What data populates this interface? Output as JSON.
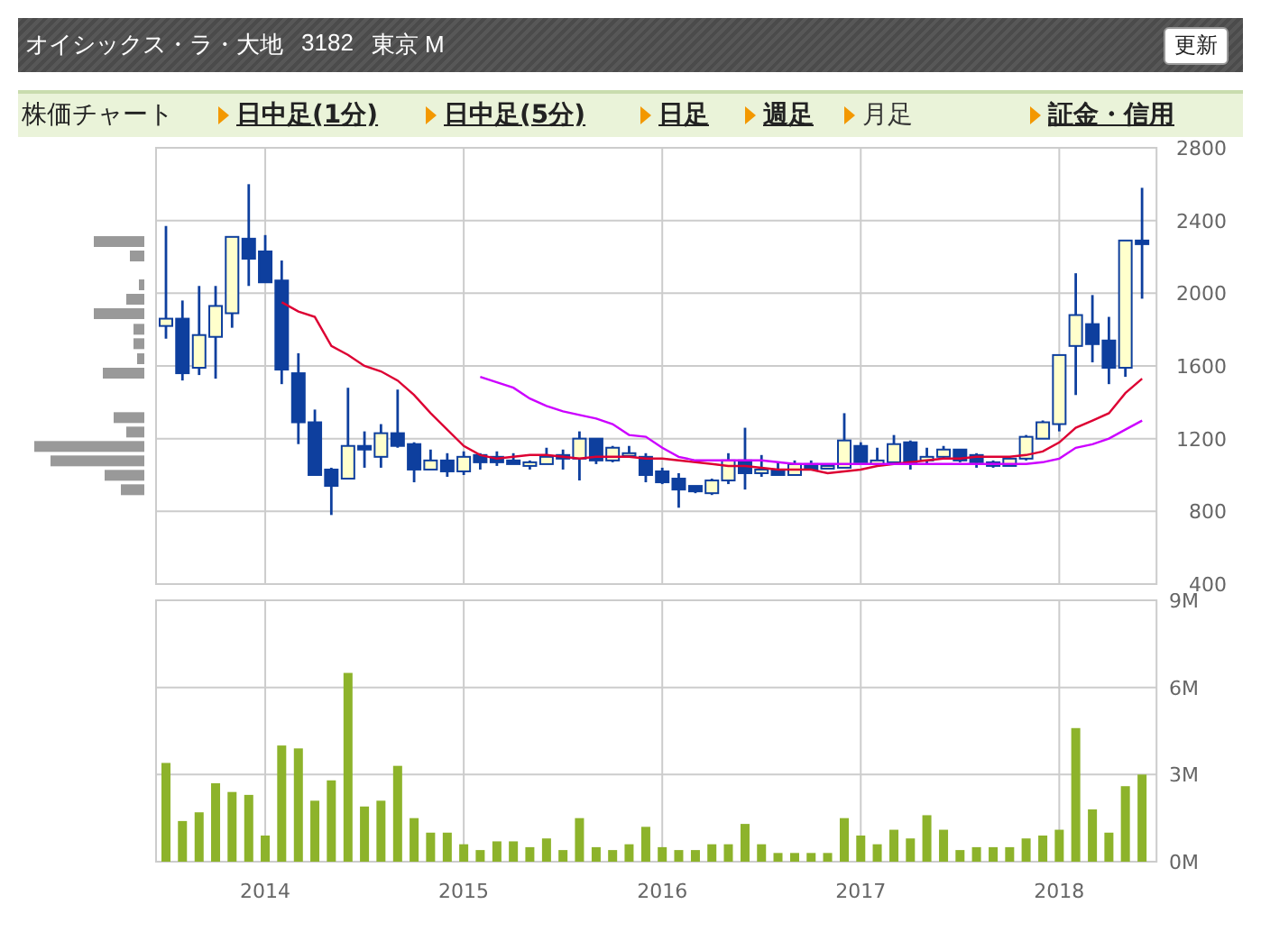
{
  "header": {
    "name": "オイシックス・ラ・大地",
    "code": "3182",
    "market": "東京 M",
    "refresh_button": "更新"
  },
  "nav": {
    "label": "株価チャート",
    "tabs": [
      {
        "label": "日中足(1分)",
        "selected": false
      },
      {
        "label": "日中足(5分)",
        "selected": false
      },
      {
        "label": "日足",
        "selected": false
      },
      {
        "label": "週足",
        "selected": false
      },
      {
        "label": "月足",
        "selected": true
      },
      {
        "label": "証金・信用",
        "selected": false
      }
    ]
  },
  "price_chart": {
    "chart_data": {
      "type": "candlestick",
      "grid": true,
      "ylim": [
        400,
        2800
      ],
      "yticks": [
        400,
        800,
        1200,
        1600,
        2000,
        2400,
        2800
      ],
      "xlim": [
        2013.45,
        2018.49
      ],
      "x": [
        2013.5,
        2013.583,
        2013.667,
        2013.75,
        2013.833,
        2013.917,
        2014,
        2014.083,
        2014.167,
        2014.25,
        2014.333,
        2014.417,
        2014.5,
        2014.583,
        2014.667,
        2014.75,
        2014.833,
        2014.917,
        2015,
        2015.083,
        2015.167,
        2015.25,
        2015.333,
        2015.417,
        2015.5,
        2015.583,
        2015.667,
        2015.75,
        2015.833,
        2015.917,
        2016,
        2016.083,
        2016.167,
        2016.25,
        2016.333,
        2016.417,
        2016.5,
        2016.583,
        2016.667,
        2016.75,
        2016.833,
        2016.917,
        2017,
        2017.083,
        2017.167,
        2017.25,
        2017.333,
        2017.417,
        2017.5,
        2017.583,
        2017.667,
        2017.75,
        2017.833,
        2017.917,
        2018,
        2018.083,
        2018.167,
        2018.25,
        2018.333,
        2018.417
      ],
      "ohlc": [
        [
          1820,
          2370,
          1750,
          1860
        ],
        [
          1860,
          1960,
          1520,
          1560
        ],
        [
          1590,
          2040,
          1550,
          1770
        ],
        [
          1760,
          2040,
          1530,
          1930
        ],
        [
          1890,
          2310,
          1810,
          2310
        ],
        [
          2300,
          2600,
          2040,
          2190
        ],
        [
          2230,
          2320,
          2060,
          2060
        ],
        [
          2070,
          2180,
          1500,
          1580
        ],
        [
          1560,
          1670,
          1170,
          1290
        ],
        [
          1290,
          1360,
          1000,
          1000
        ],
        [
          1030,
          1040,
          780,
          940
        ],
        [
          980,
          1480,
          980,
          1160
        ],
        [
          1160,
          1240,
          1040,
          1140
        ],
        [
          1100,
          1280,
          1040,
          1230
        ],
        [
          1230,
          1470,
          1150,
          1160
        ],
        [
          1170,
          1180,
          960,
          1030
        ],
        [
          1030,
          1140,
          1030,
          1080
        ],
        [
          1080,
          1120,
          990,
          1020
        ],
        [
          1020,
          1130,
          1000,
          1100
        ],
        [
          1110,
          1120,
          1030,
          1070
        ],
        [
          1100,
          1130,
          1050,
          1070
        ],
        [
          1080,
          1120,
          1060,
          1060
        ],
        [
          1050,
          1080,
          1030,
          1070
        ],
        [
          1060,
          1150,
          1060,
          1100
        ],
        [
          1110,
          1140,
          1030,
          1090
        ],
        [
          1090,
          1240,
          970,
          1200
        ],
        [
          1200,
          1200,
          1060,
          1080
        ],
        [
          1080,
          1160,
          1070,
          1150
        ],
        [
          1110,
          1160,
          1100,
          1120
        ],
        [
          1100,
          1120,
          960,
          1000
        ],
        [
          1020,
          1040,
          950,
          960
        ],
        [
          980,
          1010,
          820,
          920
        ],
        [
          940,
          940,
          900,
          910
        ],
        [
          900,
          980,
          890,
          970
        ],
        [
          970,
          1120,
          950,
          1080
        ],
        [
          1080,
          1260,
          920,
          1010
        ],
        [
          1010,
          1110,
          990,
          1030
        ],
        [
          1030,
          1070,
          1000,
          1000
        ],
        [
          1000,
          1080,
          1000,
          1060
        ],
        [
          1060,
          1080,
          1030,
          1030
        ],
        [
          1040,
          1060,
          1040,
          1050
        ],
        [
          1040,
          1340,
          1040,
          1190
        ],
        [
          1160,
          1180,
          1070,
          1070
        ],
        [
          1060,
          1150,
          1060,
          1080
        ],
        [
          1070,
          1220,
          1070,
          1170
        ],
        [
          1180,
          1190,
          1030,
          1070
        ],
        [
          1080,
          1150,
          1060,
          1100
        ],
        [
          1100,
          1160,
          1090,
          1140
        ],
        [
          1140,
          1140,
          1070,
          1080
        ],
        [
          1110,
          1120,
          1040,
          1070
        ],
        [
          1070,
          1080,
          1040,
          1050
        ],
        [
          1050,
          1100,
          1050,
          1090
        ],
        [
          1090,
          1220,
          1080,
          1210
        ],
        [
          1200,
          1300,
          1200,
          1290
        ],
        [
          1280,
          1660,
          1240,
          1660
        ],
        [
          1710,
          2110,
          1440,
          1880
        ],
        [
          1830,
          1990,
          1620,
          1720
        ],
        [
          1740,
          1870,
          1500,
          1590
        ],
        [
          1590,
          2290,
          1540,
          2290
        ],
        [
          2290,
          2580,
          1970,
          2270
        ]
      ],
      "series": [
        {
          "type": "line",
          "color": "#dd0033",
          "values": [
            null,
            null,
            null,
            null,
            null,
            null,
            null,
            1950,
            1900,
            1870,
            1710,
            1660,
            1600,
            1570,
            1520,
            1440,
            1340,
            1250,
            1160,
            1110,
            1090,
            1100,
            1110,
            1110,
            1100,
            1090,
            1100,
            1100,
            1100,
            1090,
            1090,
            1080,
            1070,
            1060,
            1050,
            1050,
            1040,
            1030,
            1030,
            1030,
            1010,
            1020,
            1030,
            1050,
            1060,
            1070,
            1080,
            1090,
            1090,
            1100,
            1100,
            1100,
            1110,
            1130,
            1180,
            1260,
            1300,
            1340,
            1450,
            1530
          ]
        },
        {
          "type": "line",
          "color": "#cc00ff",
          "values": [
            null,
            null,
            null,
            null,
            null,
            null,
            null,
            null,
            null,
            null,
            null,
            null,
            null,
            null,
            null,
            null,
            null,
            null,
            null,
            1540,
            1510,
            1480,
            1420,
            1380,
            1350,
            1330,
            1310,
            1280,
            1220,
            1210,
            1150,
            1100,
            1080,
            1080,
            1080,
            1080,
            1080,
            1070,
            1060,
            1060,
            1060,
            1060,
            1060,
            1060,
            1060,
            1060,
            1060,
            1060,
            1060,
            1060,
            1060,
            1060,
            1060,
            1070,
            1090,
            1150,
            1170,
            1200,
            1250,
            1300
          ]
        }
      ]
    }
  },
  "volume_chart": {
    "chart_data": {
      "type": "bar",
      "grid": true,
      "ylim": [
        0,
        9
      ],
      "yticks": [
        {
          "value": 0,
          "label": "0M"
        },
        {
          "value": 3,
          "label": "3M"
        },
        {
          "value": 6,
          "label": "6M"
        },
        {
          "value": 9,
          "label": "9M"
        }
      ],
      "xlim": [
        2013.45,
        2018.49
      ],
      "xticks": [
        2014,
        2015,
        2016,
        2017,
        2018
      ],
      "x": [
        2013.5,
        2013.583,
        2013.667,
        2013.75,
        2013.833,
        2013.917,
        2014,
        2014.083,
        2014.167,
        2014.25,
        2014.333,
        2014.417,
        2014.5,
        2014.583,
        2014.667,
        2014.75,
        2014.833,
        2014.917,
        2015,
        2015.083,
        2015.167,
        2015.25,
        2015.333,
        2015.417,
        2015.5,
        2015.583,
        2015.667,
        2015.75,
        2015.833,
        2015.917,
        2016,
        2016.083,
        2016.167,
        2016.25,
        2016.333,
        2016.417,
        2016.5,
        2016.583,
        2016.667,
        2016.75,
        2016.833,
        2016.917,
        2017,
        2017.083,
        2017.167,
        2017.25,
        2017.333,
        2017.417,
        2017.5,
        2017.583,
        2017.667,
        2017.75,
        2017.833,
        2017.917,
        2018,
        2018.083,
        2018.167,
        2018.25,
        2018.333,
        2018.417
      ],
      "series": [
        {
          "color": "#8db32b",
          "values": [
            3.4,
            1.4,
            1.7,
            2.7,
            2.4,
            2.3,
            0.9,
            4.0,
            3.9,
            2.1,
            2.8,
            6.5,
            1.9,
            2.1,
            3.3,
            1.5,
            1.0,
            1.0,
            0.6,
            0.4,
            0.7,
            0.7,
            0.5,
            0.8,
            0.4,
            1.5,
            0.5,
            0.4,
            0.6,
            1.2,
            0.5,
            0.4,
            0.4,
            0.6,
            0.6,
            1.3,
            0.6,
            0.3,
            0.3,
            0.3,
            0.3,
            1.5,
            0.9,
            0.6,
            1.1,
            0.8,
            1.6,
            1.1,
            0.4,
            0.5,
            0.5,
            0.5,
            0.8,
            0.9,
            1.1,
            4.6,
            1.8,
            1.0,
            2.6,
            3.0
          ]
        }
      ]
    }
  }
}
